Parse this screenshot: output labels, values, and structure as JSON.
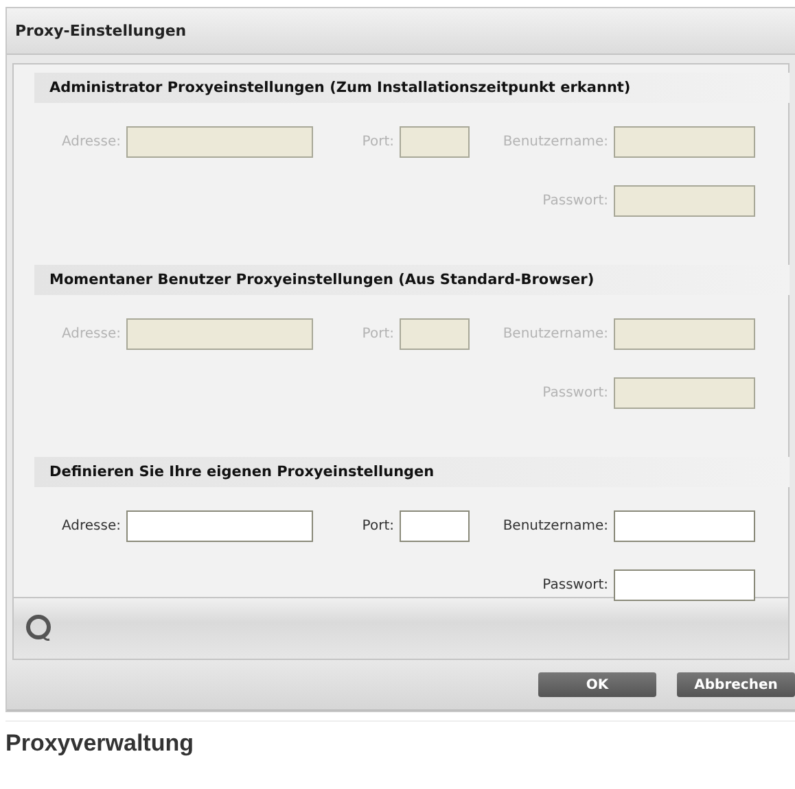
{
  "dialog": {
    "title": "Proxy-Einstellungen",
    "sections": [
      {
        "title": "Administrator Proxyeinstellungen (Zum Installationszeitpunkt erkannt)",
        "disabled": true,
        "fields": [
          {
            "label": "Adresse:"
          },
          {
            "label": "Port:"
          },
          {
            "label": "Benutzername:"
          },
          {
            "label": "Passwort:"
          }
        ]
      },
      {
        "title": "Momentaner Benutzer Proxyeinstellungen (Aus Standard-Browser)",
        "disabled": true,
        "fields": [
          {
            "label": "Adresse:"
          },
          {
            "label": "Port:"
          },
          {
            "label": "Benutzername:"
          },
          {
            "label": "Passwort:"
          }
        ]
      },
      {
        "title": "Definieren Sie Ihre eigenen Proxyeinstellungen",
        "disabled": false,
        "fields": [
          {
            "label": "Adresse:"
          },
          {
            "label": "Port:"
          },
          {
            "label": "Benutzername:"
          },
          {
            "label": "Passwort:"
          }
        ]
      }
    ],
    "buttons": [
      "OK",
      "Abbrechen"
    ]
  },
  "caption": "Proxyverwaltung"
}
